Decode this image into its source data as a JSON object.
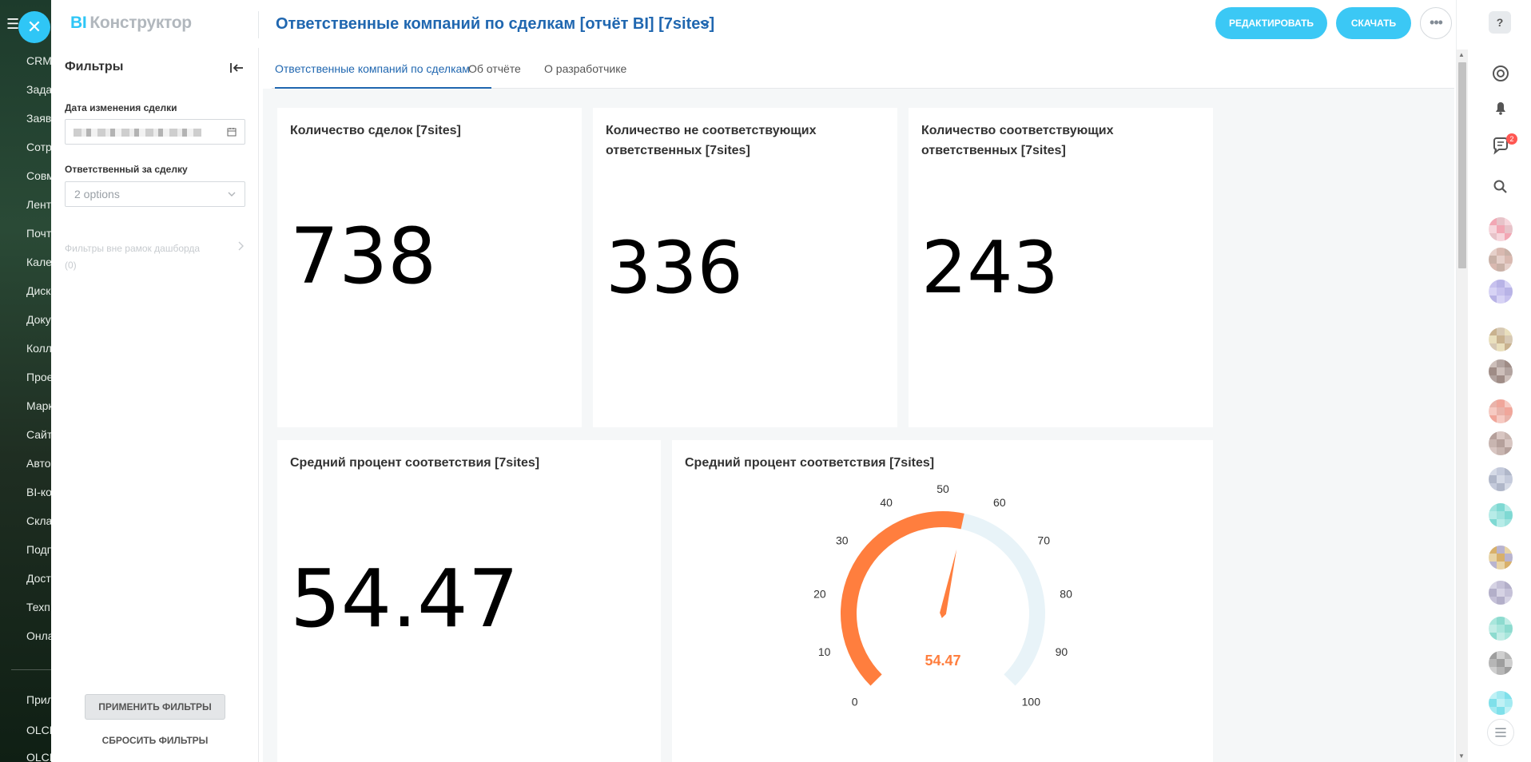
{
  "background_nav": {
    "items": [
      "CRM",
      "Задачи",
      "Заявки",
      "Сотр",
      "Совм",
      "Лента",
      "Почта",
      "Кален",
      "Диск",
      "Доку",
      "Колл",
      "Проек",
      "Марк",
      "Сайты",
      "Авто",
      "BI-ко",
      "Склад",
      "Подп",
      "Дост",
      "Техп",
      "Онла",
      "Прил",
      "OLCH",
      "OLCH"
    ]
  },
  "brand": {
    "bi": "BI",
    "name": "Конструктор"
  },
  "header": {
    "report_title": "Ответственные компаний по сделкам [отчёт BI] [7sites]",
    "edit_label": "РЕДАКТИРОВАТЬ",
    "download_label": "СКАЧАТЬ",
    "more_label": "•••"
  },
  "filters": {
    "title": "Фильтры",
    "deal_date_label": "Дата изменения сделки",
    "responsible_label": "Ответственный за сделку",
    "responsible_value": "2 options",
    "outside_label": "Фильтры вне рамок дашборда",
    "outside_count": "(0)",
    "apply_label": "ПРИМЕНИТЬ ФИЛЬТРЫ",
    "reset_label": "СБРОСИТЬ ФИЛЬТРЫ"
  },
  "tabs": [
    {
      "label": "Ответственные компаний по сделкам",
      "active": true
    },
    {
      "label": "Об отчёте",
      "active": false
    },
    {
      "label": "О разработчике",
      "active": false
    }
  ],
  "cards": {
    "deals_count": {
      "title": "Количество сделок [7sites]",
      "value": "738"
    },
    "mismatch": {
      "title": "Количество не соответствующих ответственных [7sites]",
      "value": "336"
    },
    "match": {
      "title": "Количество соответствующих ответственных [7sites]",
      "value": "243"
    },
    "avg_percent": {
      "title": "Средний процент соответствия [7sites]",
      "value": "54.47"
    },
    "gauge": {
      "title": "Средний процент соответствия [7sites]"
    }
  },
  "chart_data": {
    "type": "gauge",
    "value": 54.47,
    "value_label": "54.47",
    "min": 0,
    "max": 100,
    "ticks": [
      "0",
      "10",
      "20",
      "30",
      "40",
      "50",
      "60",
      "70",
      "80",
      "90",
      "100"
    ],
    "fill_color": "#ff7e3e",
    "track_color": "#e8f3f8",
    "needle_color": "#ff7e3e"
  },
  "rightbar": {
    "help": "?",
    "badge": "2"
  },
  "colors": {
    "accent": "#2fc6f6",
    "link": "#2067b0",
    "orange": "#ff7e3e"
  }
}
